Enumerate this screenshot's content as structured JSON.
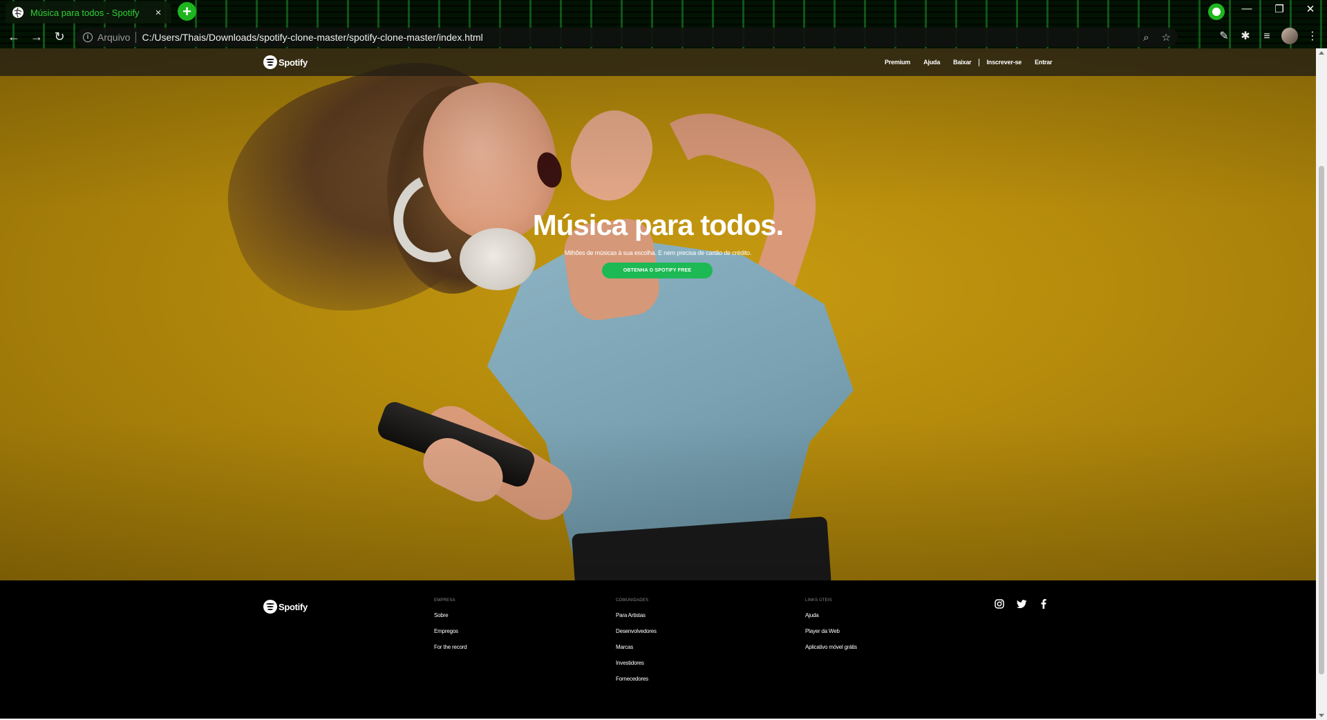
{
  "browser": {
    "tab_title": "Música para todos - Spotify",
    "tab_close": "×",
    "new_tab": "+",
    "address_scheme": "Arquivo",
    "address_url": "C:/Users/Thais/Downloads/spotify-clone-master/spotify-clone-master/index.html",
    "window_controls": {
      "minimize": "—",
      "restore": "❐",
      "close": "✕"
    }
  },
  "site": {
    "logo_text": "Spotify",
    "nav": {
      "premium": "Premium",
      "ajuda": "Ajuda",
      "baixar": "Baixar",
      "inscrever": "Inscrever-se",
      "entrar": "Entrar"
    },
    "hero": {
      "title": "Música para todos.",
      "subtitle": "Milhões de músicas à sua escolha. E nem precisa de cartão de crédito.",
      "cta": "OBTENHA O SPOTIFY FREE"
    },
    "footer": {
      "logo_text": "Spotify",
      "columns": [
        {
          "heading": "EMPRESA",
          "links": [
            "Sobre",
            "Empregos",
            "For the record"
          ]
        },
        {
          "heading": "COMUNIDADES",
          "links": [
            "Para Artistas",
            "Desenvolvedores",
            "Marcas",
            "Investidores",
            "Fornecedores"
          ]
        },
        {
          "heading": "LINKS ÚTEIS",
          "links": [
            "Ajuda",
            "Player da Web",
            "Aplicativo móvel grátis"
          ]
        }
      ],
      "social_icons": [
        "instagram-icon",
        "twitter-icon",
        "facebook-icon"
      ]
    },
    "colors": {
      "spotify_green": "#1db954",
      "hero_yellow": "#c79a10",
      "footer_bg": "#000000"
    }
  }
}
